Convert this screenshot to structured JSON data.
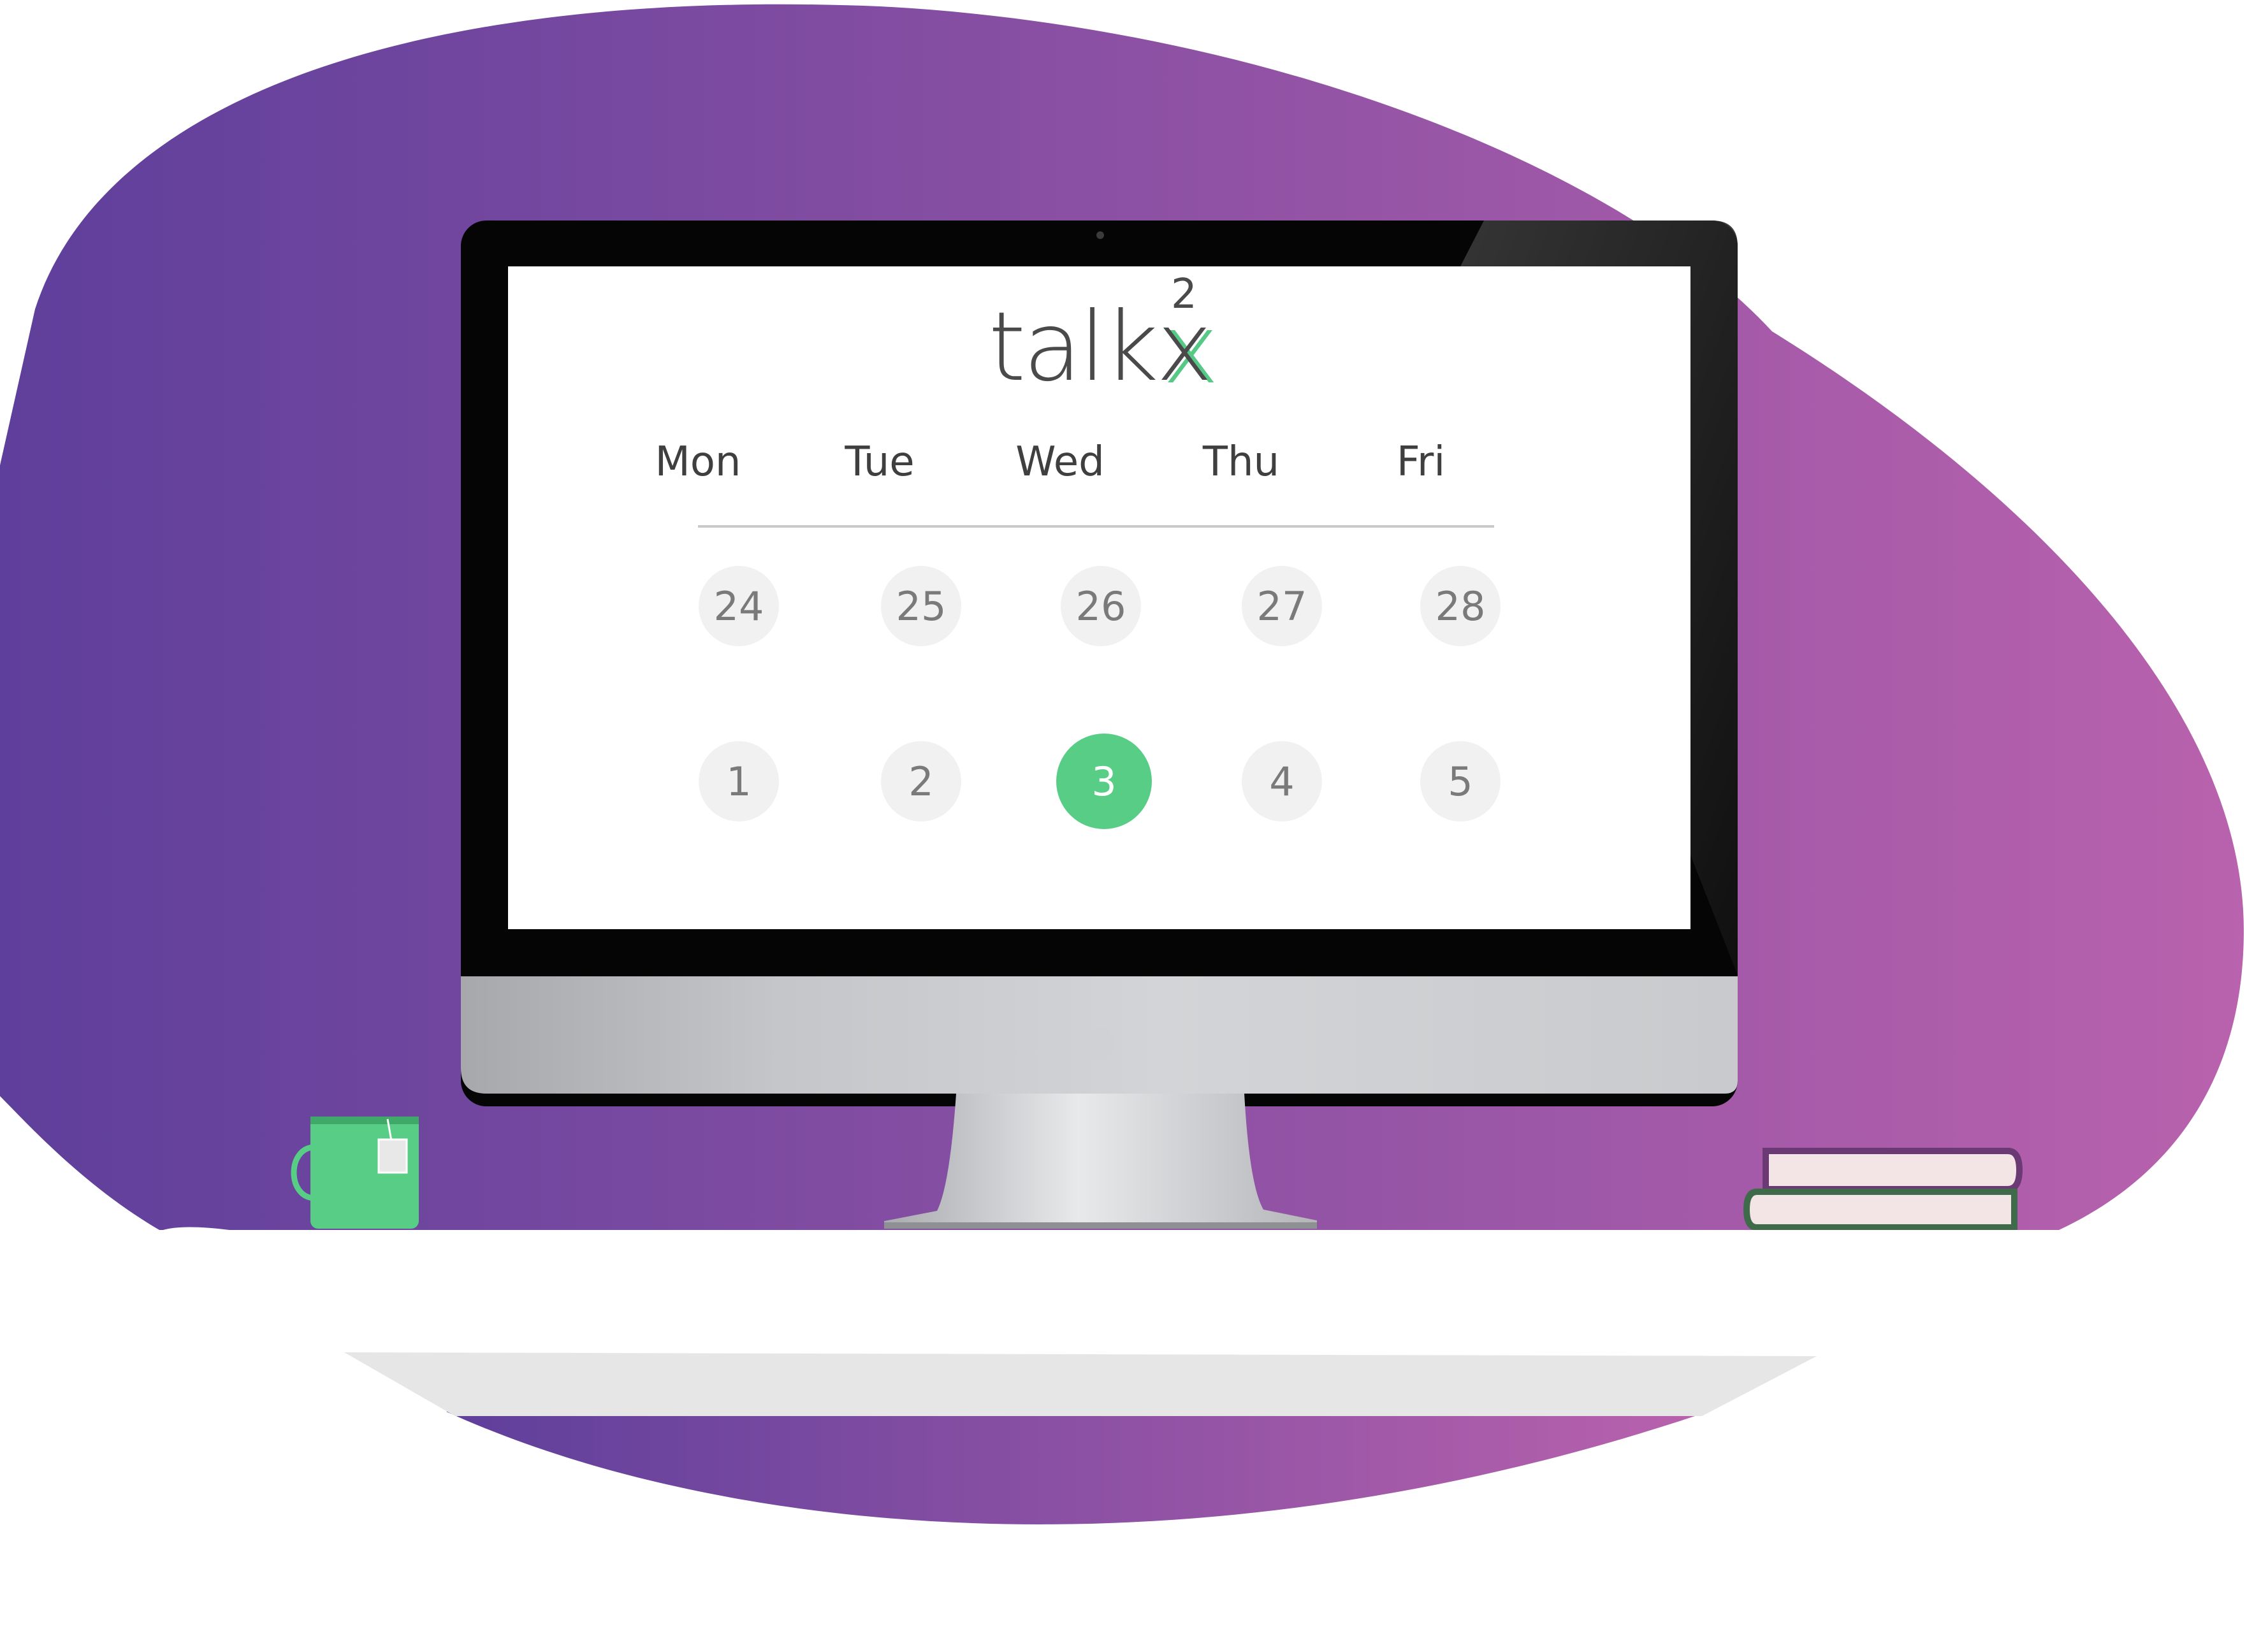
{
  "brand": {
    "name": "talkx",
    "word": "talk",
    "x_letter": "x",
    "superscript": "2",
    "accent_color": "#57cd86"
  },
  "calendar": {
    "weekdays": [
      "Mon",
      "Tue",
      "Wed",
      "Thu",
      "Fri"
    ],
    "weeks": [
      [
        "24",
        "25",
        "26",
        "27",
        "28"
      ],
      [
        "1",
        "2",
        "3",
        "4",
        "5"
      ]
    ],
    "selected_day": "3"
  },
  "scene": {
    "background_gradient": [
      "#5e3f9b",
      "#b962ad"
    ],
    "mug_color": "#57cd86",
    "book_colors": [
      "#6b3a74",
      "#3f6b4a"
    ],
    "desk_color": "#ffffff",
    "desk_shadow_color": "#e6e6e6"
  }
}
